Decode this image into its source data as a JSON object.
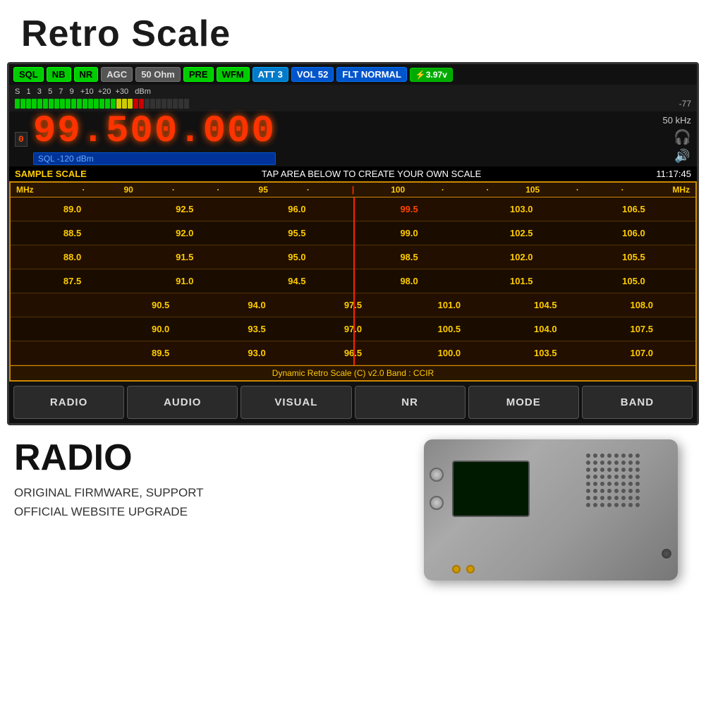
{
  "title": "Retro Scale",
  "screen": {
    "badges": [
      {
        "label": "SQL",
        "class": "badge-green"
      },
      {
        "label": "NB",
        "class": "badge-green"
      },
      {
        "label": "NR",
        "class": "badge-green"
      },
      {
        "label": "AGC",
        "class": "badge-gray"
      },
      {
        "label": "50 Ohm",
        "class": "badge-gray"
      },
      {
        "label": "PRE",
        "class": "badge-green"
      },
      {
        "label": "WFM",
        "class": "badge-green"
      },
      {
        "label": "ATT 3",
        "class": "badge-cyan"
      },
      {
        "label": "VOL 52",
        "class": "badge-blue"
      },
      {
        "label": "FLT NORMAL",
        "class": "badge-blue"
      },
      {
        "label": "⚡3.97v",
        "class": "badge-battery"
      }
    ],
    "signal": {
      "scale": "S  1   3   5   7   9  +10 +20 +30  dBm",
      "dbm_value": "-77",
      "green_bars": 18,
      "yellow_bars": 3,
      "red_bars": 2
    },
    "frequency": {
      "digit_box": "0",
      "main": "99.500.000",
      "khz": "50 kHz",
      "sql_label": "SQL -120 dBm"
    },
    "scale_label": {
      "left": "SAMPLE SCALE",
      "center": "TAP AREA BELOW TO CREATE YOUR OWN SCALE",
      "time": "11:17:45"
    },
    "retro_scale": {
      "header": [
        "MHz",
        "·",
        "90",
        "·",
        "·",
        "95",
        "·",
        "|",
        "100",
        "·",
        "·",
        "105",
        "·",
        "·",
        "MHz"
      ],
      "rows": [
        [
          "89.0",
          "92.5",
          "96.0",
          "99.5",
          "103.0",
          "106.5"
        ],
        [
          "88.5",
          "92.0",
          "95.5",
          "99.0",
          "102.5",
          "106.0"
        ],
        [
          "88.0",
          "91.5",
          "95.0",
          "98.5",
          "102.0",
          "105.5"
        ],
        [
          "87.5",
          "91.0",
          "94.5",
          "98.0",
          "101.5",
          "105.0"
        ],
        [
          "",
          "90.5",
          "94.0",
          "97.5",
          "101.0",
          "104.5",
          "108.0"
        ],
        [
          "",
          "90.0",
          "93.5",
          "97.0",
          "100.5",
          "104.0",
          "107.5"
        ],
        [
          "",
          "89.5",
          "93.0",
          "96.5",
          "100.0",
          "103.5",
          "107.0"
        ]
      ],
      "highlight_col": 3,
      "footer": "Dynamic Retro Scale (C) v2.0 Band : CCIR"
    },
    "buttons": [
      "RADIO",
      "AUDIO",
      "VISUAL",
      "NR",
      "MODE",
      "BAND"
    ]
  },
  "bottom": {
    "radio_label": "RADIO",
    "firmware_lines": [
      "ORIGINAL FIRMWARE, SUPPORT",
      "OFFICIAL WEBSITE UPGRADE"
    ]
  },
  "icons": {
    "headphone": "🎧",
    "speaker": "🔊",
    "battery": "⚡"
  }
}
